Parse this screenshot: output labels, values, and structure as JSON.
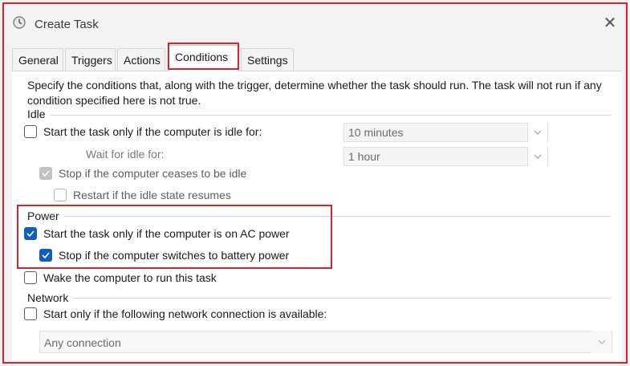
{
  "window": {
    "title": "Create Task",
    "close_glyph": "✕",
    "title_icon": "clock-icon"
  },
  "tabs": [
    {
      "label": "General"
    },
    {
      "label": "Triggers"
    },
    {
      "label": "Actions"
    },
    {
      "label": "Conditions",
      "active": true
    },
    {
      "label": "Settings"
    }
  ],
  "description": "Specify the conditions that, along with the trigger, determine whether the task should run.  The task will not run  if any condition specified here is not true.",
  "idle": {
    "group_label": "Idle",
    "start_if_idle": {
      "label": "Start the task only if the computer is idle for:",
      "checked": false
    },
    "idle_for_value": "10 minutes",
    "wait_label": "Wait for idle for:",
    "wait_value": "1 hour",
    "stop_if_not_idle": {
      "label": "Stop if the computer ceases to be idle",
      "checked": true,
      "enabled": false
    },
    "restart_if_idle": {
      "label": "Restart if the idle state resumes",
      "checked": false,
      "enabled": false
    }
  },
  "power": {
    "group_label": "Power",
    "ac_only": {
      "label": "Start the task only if the computer is on AC power",
      "checked": true
    },
    "stop_on_battery": {
      "label": "Stop if the computer switches to battery power",
      "checked": true
    },
    "wake": {
      "label": "Wake the computer to run this task",
      "checked": false
    }
  },
  "network": {
    "group_label": "Network",
    "start_if_network": {
      "label": "Start only if the following network connection is available:",
      "checked": false
    },
    "connection_value": "Any connection"
  },
  "colors": {
    "accent": "#0f5fb8",
    "highlight_box": "#d9232e"
  }
}
